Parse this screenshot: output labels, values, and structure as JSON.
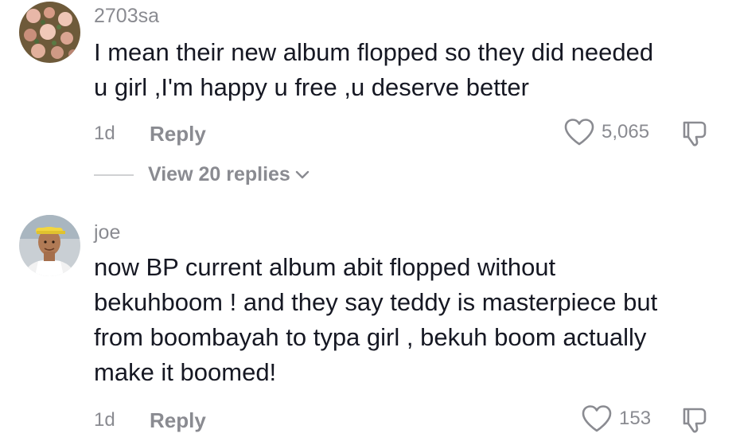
{
  "comments": [
    {
      "username": "2703sa",
      "text_lines": [
        "I mean their new album flopped so they did needed",
        "u girl ,I'm happy u free ,u deserve better"
      ],
      "time": "1d",
      "reply_label": "Reply",
      "likes": "5,065",
      "view_replies": "View 20 replies",
      "avatar_icon": "flower-avatar"
    },
    {
      "username": "joe",
      "text_lines": [
        "now BP current album abit flopped without",
        "bekuhboom ! and they say teddy is masterpiece but",
        "from boombayah to typa girl , bekuh boom actually",
        "make it boomed!"
      ],
      "time": "1d",
      "reply_label": "Reply",
      "likes": "153",
      "avatar_icon": "person-avatar"
    }
  ]
}
